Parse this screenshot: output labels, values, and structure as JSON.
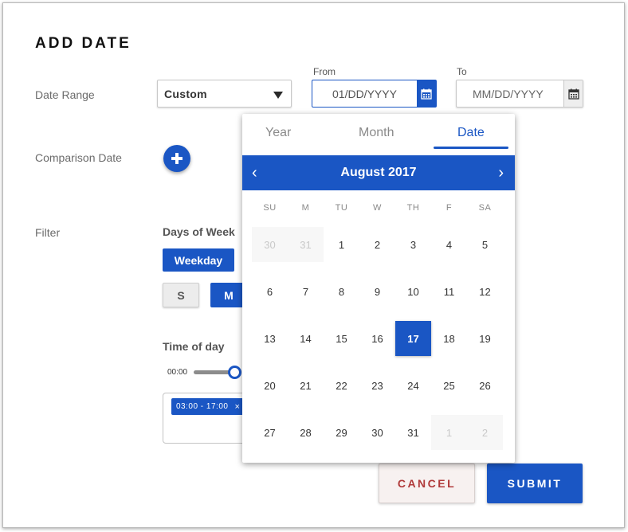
{
  "dialog": {
    "title": "ADD DATE"
  },
  "date_range": {
    "label": "Date Range",
    "select_value": "Custom",
    "from_label": "From",
    "from_value": "01/DD/YYYY",
    "to_label": "To",
    "to_placeholder": "MM/DD/YYYY"
  },
  "comparison": {
    "label": "Comparison Date"
  },
  "filter": {
    "label": "Filter",
    "days_title": "Days of Week",
    "weekday_label": "Weekday",
    "day_s": "S",
    "day_m": "M",
    "time_title": "Time of day",
    "slider_start": "00:00",
    "chip_label": "03:00 - 17:00",
    "chip_remove": "×"
  },
  "actions": {
    "cancel": "CANCEL",
    "submit": "SUBMIT"
  },
  "calendar": {
    "tabs": [
      "Year",
      "Month",
      "Date"
    ],
    "active_tab": "Date",
    "month_label": "August 2017",
    "prev": "‹",
    "next": "›",
    "weekdays": [
      "SU",
      "M",
      "TU",
      "W",
      "TH",
      "F",
      "SA"
    ],
    "weeks": [
      [
        "30",
        "31",
        "1",
        "2",
        "3",
        "4",
        "5"
      ],
      [
        "6",
        "7",
        "8",
        "9",
        "10",
        "11",
        "12"
      ],
      [
        "13",
        "14",
        "15",
        "16",
        "17",
        "18",
        "19"
      ],
      [
        "20",
        "21",
        "22",
        "23",
        "24",
        "25",
        "26"
      ],
      [
        "27",
        "28",
        "29",
        "30",
        "31",
        "1",
        "2"
      ]
    ],
    "selected_day": "17"
  },
  "colors": {
    "accent": "#1a56c4",
    "cancel_text": "#b03a3a"
  }
}
